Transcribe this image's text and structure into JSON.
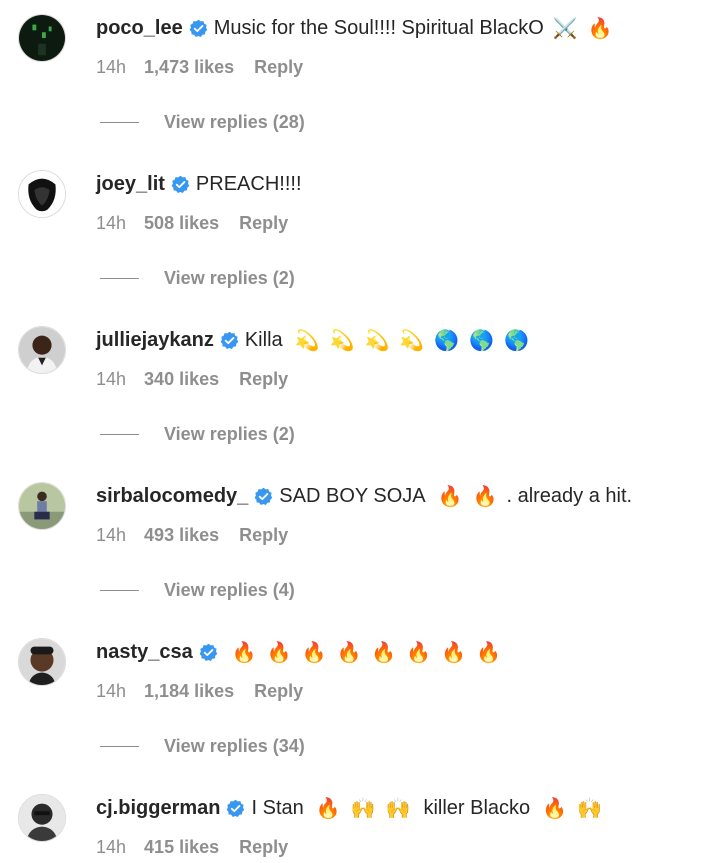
{
  "comments": [
    {
      "username": "poco_lee",
      "text": "Music for the Soul!!!! Spiritual BlackO",
      "emojis_after": [
        "⚔️",
        "🔥"
      ],
      "time": "14h",
      "likes": "1,473 likes",
      "reply": "Reply",
      "view_replies": "View replies (28)"
    },
    {
      "username": "joey_lit",
      "text": "PREACH!!!!",
      "emojis_after": [],
      "time": "14h",
      "likes": "508 likes",
      "reply": "Reply",
      "view_replies": "View replies (2)"
    },
    {
      "username": "julliejaykanz",
      "text": "Killa",
      "emojis_after": [
        "💫",
        "💫",
        "💫",
        "💫",
        "🌎",
        "🌎",
        "🌎"
      ],
      "time": "14h",
      "likes": "340 likes",
      "reply": "Reply",
      "view_replies": "View replies (2)"
    },
    {
      "username": "sirbalocomedy_",
      "text": "SAD BOY SOJA",
      "emojis_after": [
        "🔥",
        "🔥"
      ],
      "text_after": ". already a hit.",
      "time": "14h",
      "likes": "493 likes",
      "reply": "Reply",
      "view_replies": "View replies (4)"
    },
    {
      "username": "nasty_csa",
      "text": "",
      "emojis_after": [
        "🔥",
        "🔥",
        "🔥",
        "🔥",
        "🔥",
        "🔥",
        "🔥",
        "🔥"
      ],
      "time": "14h",
      "likes": "1,184 likes",
      "reply": "Reply",
      "view_replies": "View replies (34)"
    },
    {
      "username": "cj.biggerman",
      "text": "I Stan",
      "emojis_after": [
        "🔥",
        "🙌",
        "🙌"
      ],
      "text_after": "killer Blacko",
      "emojis_end": [
        "🔥",
        "🙌"
      ],
      "time": "14h",
      "likes": "415 likes",
      "reply": "Reply"
    }
  ],
  "colors": {
    "text": "#262626",
    "secondary": "#8e8e8e",
    "verified": "#3897f0"
  }
}
